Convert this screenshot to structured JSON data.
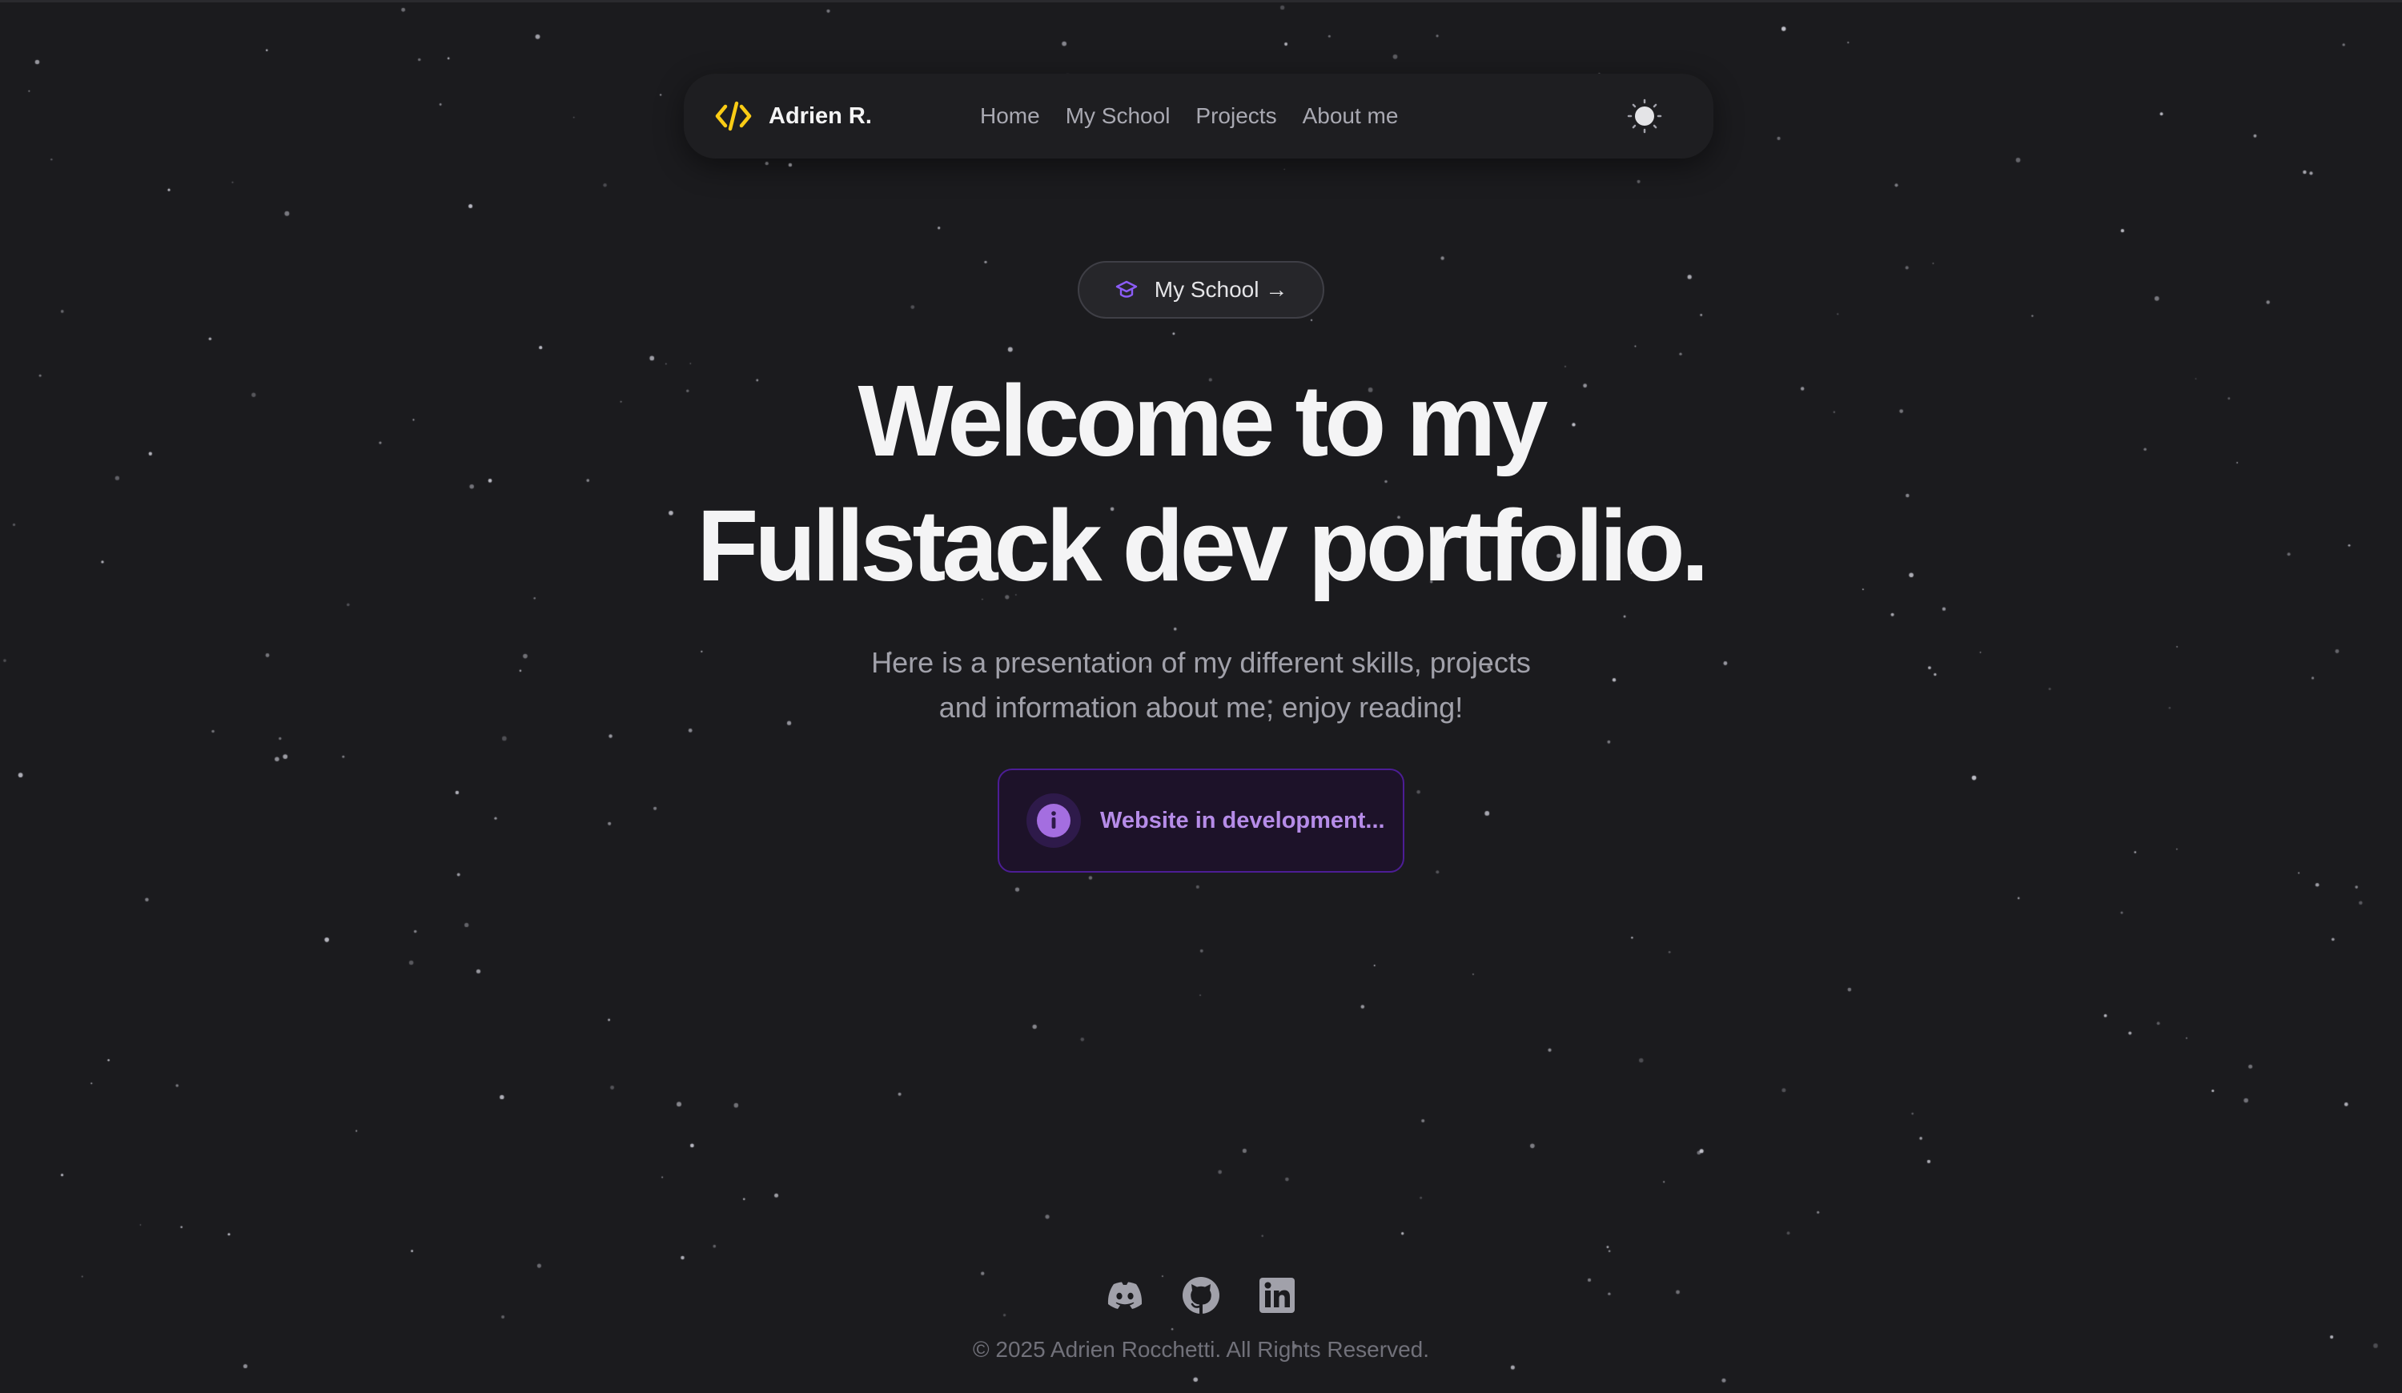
{
  "navbar": {
    "brand_name": "Adrien R.",
    "brand_icon": "code-icon",
    "links": [
      {
        "label": "Home"
      },
      {
        "label": "My School"
      },
      {
        "label": "Projects"
      },
      {
        "label": "About me"
      }
    ],
    "theme_icon": "sun-icon"
  },
  "badge": {
    "label": "My School →",
    "icon": "graduation-cap-icon"
  },
  "hero": {
    "title_line1": "Welcome to my",
    "title_line2": "Fullstack dev portfolio.",
    "subtitle_line1": "Here is a presentation of my different skills, projects",
    "subtitle_line2": "and information about me, enjoy reading!"
  },
  "notice": {
    "text": "Website in development...",
    "icon": "info-icon"
  },
  "footer": {
    "socials": [
      {
        "icon": "discord-icon"
      },
      {
        "icon": "github-icon"
      },
      {
        "icon": "linkedin-icon"
      }
    ],
    "copyright": "© 2025 Adrien Rocchetti. All Rights Reserved."
  },
  "colors": {
    "background": "#1b1b1e",
    "accent_yellow": "#facc15",
    "accent_purple": "#a46ee0",
    "notice_text": "#b68ce8"
  }
}
